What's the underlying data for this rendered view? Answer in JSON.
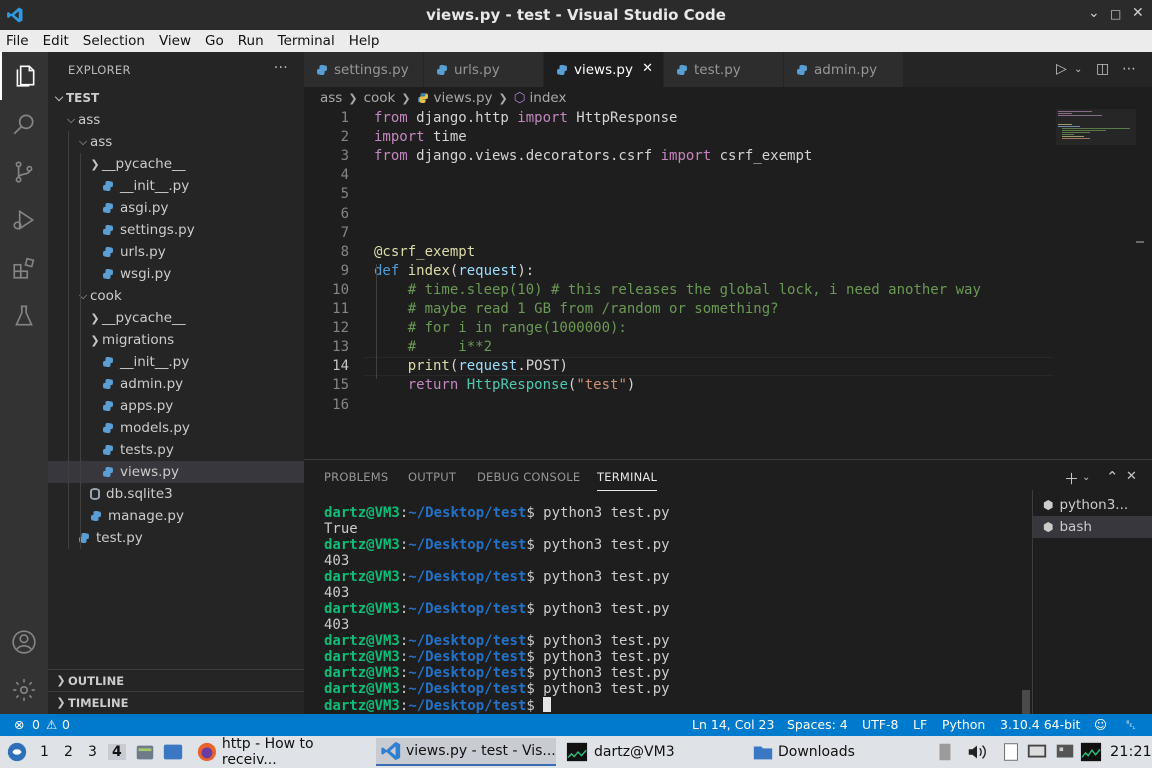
{
  "window": {
    "title": "views.py - test - Visual Studio Code",
    "controls": [
      "minimize-icon",
      "maximize-icon",
      "close-icon"
    ]
  },
  "menu": [
    "File",
    "Edit",
    "Selection",
    "View",
    "Go",
    "Run",
    "Terminal",
    "Help"
  ],
  "sidebar": {
    "title": "EXPLORER",
    "more": "···",
    "root": "TEST",
    "tree": [
      {
        "label": "ass",
        "type": "folder",
        "depth": 1,
        "open": true
      },
      {
        "label": "ass",
        "type": "folder",
        "depth": 2,
        "open": true
      },
      {
        "label": "__pycache__",
        "type": "folder",
        "depth": 3,
        "open": false
      },
      {
        "label": "__init__.py",
        "type": "py",
        "depth": 3
      },
      {
        "label": "asgi.py",
        "type": "py",
        "depth": 3
      },
      {
        "label": "settings.py",
        "type": "py",
        "depth": 3
      },
      {
        "label": "urls.py",
        "type": "py",
        "depth": 3
      },
      {
        "label": "wsgi.py",
        "type": "py",
        "depth": 3
      },
      {
        "label": "cook",
        "type": "folder",
        "depth": 2,
        "open": true
      },
      {
        "label": "__pycache__",
        "type": "folder",
        "depth": 3,
        "open": false
      },
      {
        "label": "migrations",
        "type": "folder",
        "depth": 3,
        "open": false
      },
      {
        "label": "__init__.py",
        "type": "py",
        "depth": 3
      },
      {
        "label": "admin.py",
        "type": "py",
        "depth": 3
      },
      {
        "label": "apps.py",
        "type": "py",
        "depth": 3
      },
      {
        "label": "models.py",
        "type": "py",
        "depth": 3
      },
      {
        "label": "tests.py",
        "type": "py",
        "depth": 3
      },
      {
        "label": "views.py",
        "type": "py",
        "depth": 3,
        "selected": true
      },
      {
        "label": "db.sqlite3",
        "type": "db",
        "depth": 2
      },
      {
        "label": "manage.py",
        "type": "py",
        "depth": 2
      },
      {
        "label": "test.py",
        "type": "py",
        "depth": 1
      }
    ],
    "outline": "OUTLINE",
    "timeline": "TIMELINE"
  },
  "tabs": [
    {
      "label": "settings.py",
      "active": false
    },
    {
      "label": "urls.py",
      "active": false
    },
    {
      "label": "views.py",
      "active": true
    },
    {
      "label": "test.py",
      "active": false
    },
    {
      "label": "admin.py",
      "active": false
    }
  ],
  "breadcrumb": [
    "ass",
    "cook",
    "views.py",
    "index"
  ],
  "editor": {
    "current_line": 14,
    "lines": [
      [
        [
          "kw",
          "from"
        ],
        [
          "t",
          " django.http "
        ],
        [
          "kw",
          "import"
        ],
        [
          "t",
          " HttpResponse"
        ]
      ],
      [
        [
          "kw",
          "import"
        ],
        [
          "t",
          " time"
        ]
      ],
      [
        [
          "kw",
          "from"
        ],
        [
          "t",
          " django.views.decorators.csrf "
        ],
        [
          "kw",
          "import"
        ],
        [
          "t",
          " csrf_exempt"
        ]
      ],
      [],
      [],
      [],
      [],
      [
        [
          "deco",
          "@csrf_exempt"
        ]
      ],
      [
        [
          "kb",
          "def"
        ],
        [
          "t",
          " "
        ],
        [
          "fn",
          "index"
        ],
        [
          "t",
          "("
        ],
        [
          "vr",
          "request"
        ],
        [
          "t",
          "):"
        ]
      ],
      [
        [
          "t",
          "    "
        ],
        [
          "cm",
          "# time.sleep(10) # this releases the global lock, i need another way"
        ]
      ],
      [
        [
          "t",
          "    "
        ],
        [
          "cm",
          "# maybe read 1 GB from /random or something?"
        ]
      ],
      [
        [
          "t",
          "    "
        ],
        [
          "cm",
          "# for i in range(1000000):"
        ]
      ],
      [
        [
          "t",
          "    "
        ],
        [
          "cm",
          "#     i**2"
        ]
      ],
      [
        [
          "t",
          "    "
        ],
        [
          "fn",
          "print"
        ],
        [
          "t",
          "("
        ],
        [
          "vr",
          "request"
        ],
        [
          "t",
          ".POST)"
        ]
      ],
      [
        [
          "t",
          "    "
        ],
        [
          "kw",
          "return"
        ],
        [
          "t",
          " "
        ],
        [
          "cls",
          "HttpResponse"
        ],
        [
          "t",
          "("
        ],
        [
          "st",
          "\"test\""
        ],
        [
          "t",
          ")"
        ]
      ],
      []
    ]
  },
  "panel": {
    "tabs": [
      "PROBLEMS",
      "OUTPUT",
      "DEBUG CONSOLE",
      "TERMINAL"
    ],
    "active_tab": "TERMINAL",
    "prompt_user": "dartz@VM3",
    "prompt_colon": ":",
    "prompt_path": "~/Desktop/test",
    "prompt_dollar": "$",
    "terminal_lines": [
      {
        "prompt": true,
        "cmd": " python3 test.py"
      },
      {
        "prompt": false,
        "text": "True"
      },
      {
        "prompt": true,
        "cmd": " python3 test.py"
      },
      {
        "prompt": false,
        "text": "403"
      },
      {
        "prompt": true,
        "cmd": " python3 test.py"
      },
      {
        "prompt": false,
        "text": "403"
      },
      {
        "prompt": true,
        "cmd": " python3 test.py"
      },
      {
        "prompt": false,
        "text": "403"
      },
      {
        "prompt": true,
        "cmd": " python3 test.py"
      },
      {
        "prompt": true,
        "cmd": " python3 test.py"
      },
      {
        "prompt": true,
        "cmd": " python3 test.py"
      },
      {
        "prompt": true,
        "cmd": " python3 test.py"
      },
      {
        "prompt": true,
        "cmd": " ",
        "cursor": true
      }
    ],
    "terminals": [
      {
        "label": "python3...",
        "selected": false
      },
      {
        "label": "bash",
        "selected": true
      }
    ]
  },
  "status": {
    "errors": "0",
    "warnings": "0",
    "position": "Ln 14, Col 23",
    "spaces": "Spaces: 4",
    "encoding": "UTF-8",
    "eol": "LF",
    "language": "Python",
    "interpreter": "3.10.4 64-bit"
  },
  "taskbar": {
    "workspaces": [
      "1",
      "2",
      "3",
      "4"
    ],
    "active_workspace": "4",
    "windows": [
      {
        "label": "http - How to receiv...",
        "icon": "firefox-icon",
        "active": false
      },
      {
        "label": "views.py - test - Vis...",
        "icon": "vscode-icon",
        "active": true
      },
      {
        "label": "dartz@VM3",
        "icon": "terminal-icon",
        "active": false
      },
      {
        "label": "Downloads",
        "icon": "folder-icon",
        "active": false
      }
    ],
    "clock": "21:21"
  },
  "colors": {
    "accent": "#007acc",
    "prompt_user": "#0dbc79",
    "prompt_path": "#2472c8"
  }
}
